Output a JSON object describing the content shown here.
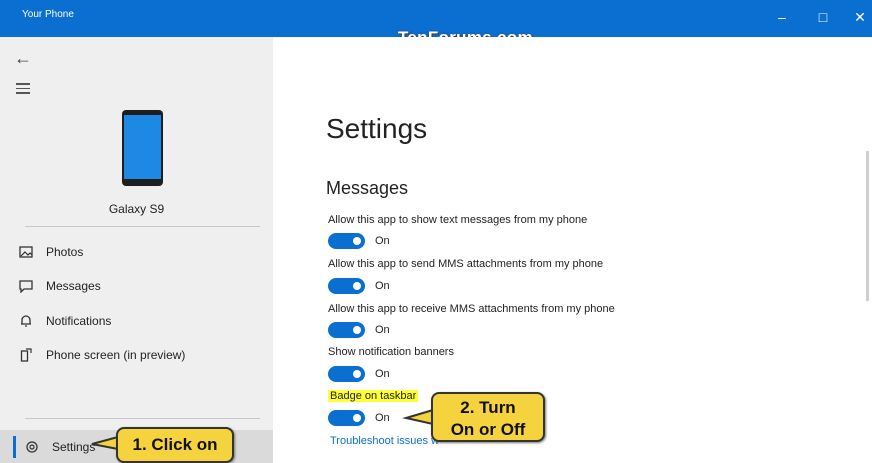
{
  "window": {
    "app_title": "Your Phone",
    "watermark": "TenForums.com",
    "controls": {
      "minimize": "–",
      "maximize": "□",
      "close": "✕"
    }
  },
  "sidebar": {
    "device_name": "Galaxy S9",
    "items": [
      {
        "label": "Photos",
        "icon": "photos-icon"
      },
      {
        "label": "Messages",
        "icon": "messages-icon"
      },
      {
        "label": "Notifications",
        "icon": "notifications-icon"
      },
      {
        "label": "Phone screen (in preview)",
        "icon": "phone-screen-icon"
      }
    ],
    "settings": {
      "label": "Settings",
      "icon": "gear-icon"
    }
  },
  "main": {
    "title": "Settings",
    "section": "Messages",
    "options": [
      {
        "label": "Allow this app to show text messages from my phone",
        "state": "On"
      },
      {
        "label": "Allow this app to send MMS attachments from my phone",
        "state": "On"
      },
      {
        "label": "Allow this app to receive MMS attachments from my phone",
        "state": "On"
      },
      {
        "label": "Show notification banners",
        "state": "On"
      },
      {
        "label": "Badge on taskbar",
        "state": "On"
      }
    ],
    "link": "Troubleshoot issues w"
  },
  "callouts": {
    "one": "1. Click on",
    "two_line1": "2. Turn",
    "two_line2": "On or Off"
  },
  "colors": {
    "accent": "#0a6fd0",
    "callout": "#f5d33f",
    "highlight": "#ffff33"
  }
}
